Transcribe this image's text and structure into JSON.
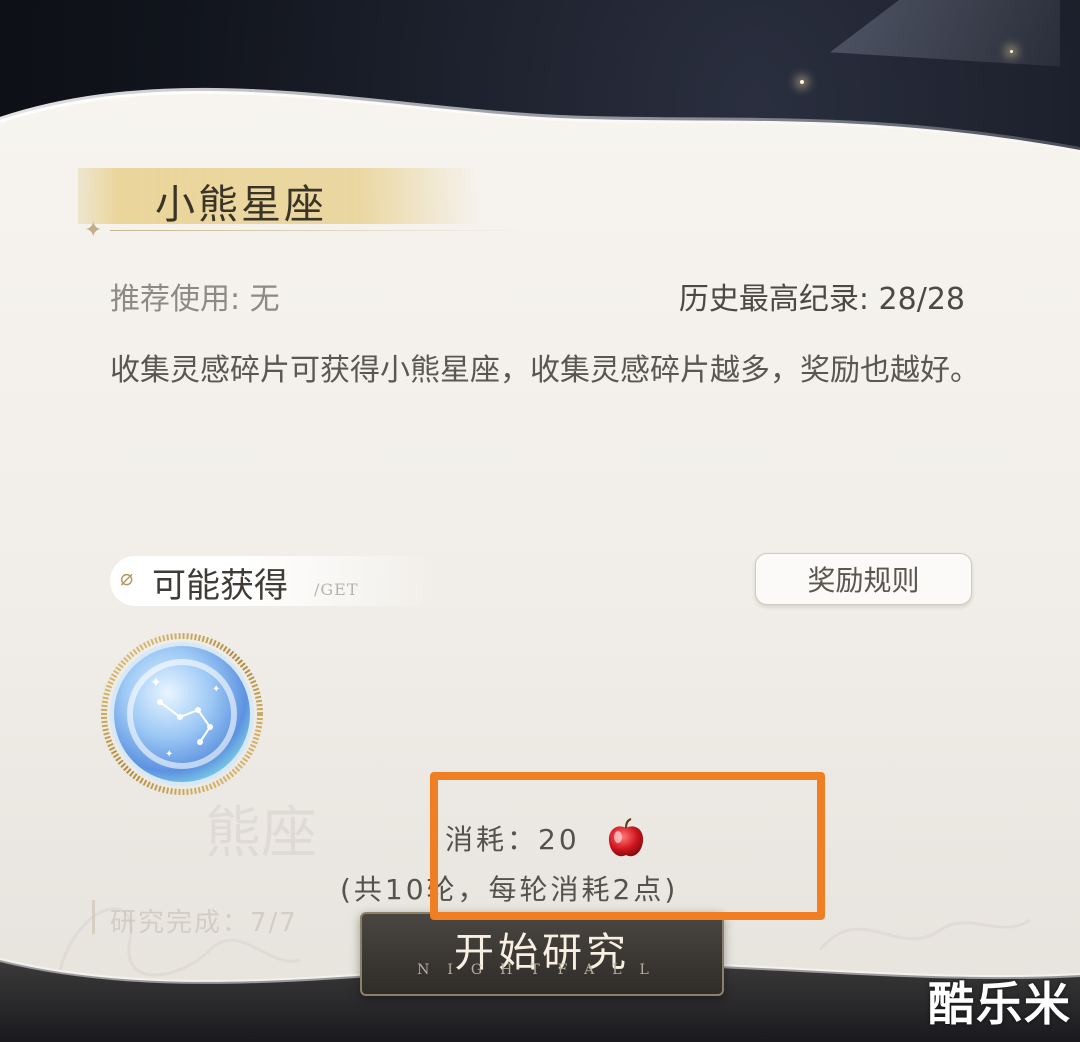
{
  "constellation": {
    "name": "小熊星座"
  },
  "info": {
    "recommended": "推荐使用: 无",
    "record": "历史最高纪录: 28/28",
    "description": "收集灵感碎片可获得小熊星座，收集灵感碎片越多，奖励也越好。"
  },
  "rewards": {
    "title": "可能获得",
    "subtitle": "/GET",
    "rules_button": "奖励规则"
  },
  "cost": {
    "label": "消耗：20",
    "rounds": "(共10轮，每轮消耗2点)"
  },
  "progress": {
    "label": "研究完成：7/7"
  },
  "start": {
    "label": "开始研究",
    "sub": "NIGHTFALL"
  },
  "watermark": {
    "text": "酷乐米"
  },
  "background_text": {
    "ghost": "熊座"
  },
  "colors": {
    "highlight": "#f07e22",
    "title_gold": "#e6cd87"
  }
}
